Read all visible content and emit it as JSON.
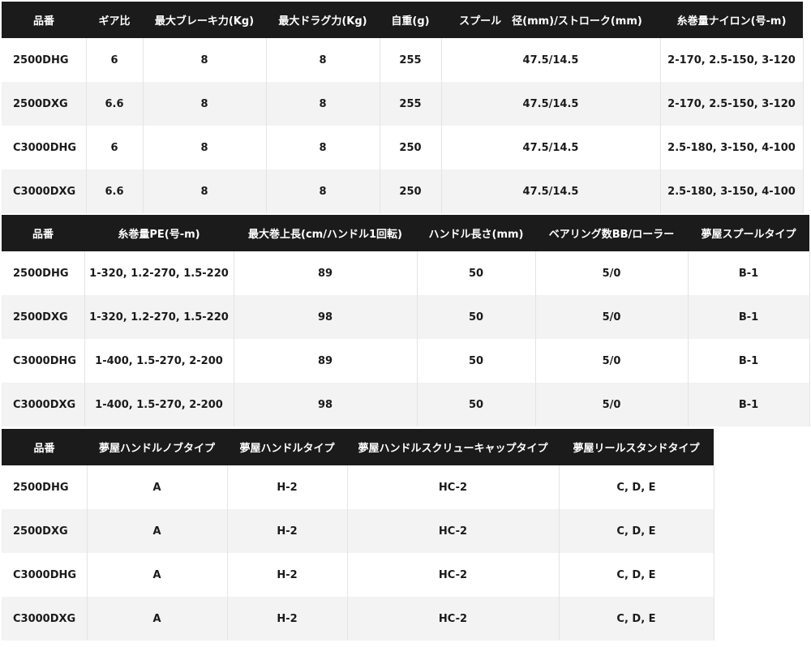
{
  "tables": [
    {
      "headers": [
        "品番",
        "ギア比",
        "最大ブレーキ力(Kg)",
        "最大ドラグ力(Kg)",
        "自重(g)",
        "スプール　径(mm)/ストローク(mm)",
        "糸巻量ナイロン(号-m)"
      ],
      "rows": [
        [
          "2500DHG",
          "6",
          "8",
          "8",
          "255",
          "47.5/14.5",
          "2-170, 2.5-150, 3-120"
        ],
        [
          "2500DXG",
          "6.6",
          "8",
          "8",
          "255",
          "47.5/14.5",
          "2-170, 2.5-150, 3-120"
        ],
        [
          "C3000DHG",
          "6",
          "8",
          "8",
          "250",
          "47.5/14.5",
          "2.5-180, 3-150, 4-100"
        ],
        [
          "C3000DXG",
          "6.6",
          "8",
          "8",
          "250",
          "47.5/14.5",
          "2.5-180, 3-150, 4-100"
        ]
      ]
    },
    {
      "headers": [
        "品番",
        "糸巻量PE(号-m)",
        "最大巻上長(cm/ハンドル1回転)",
        "ハンドル長さ(mm)",
        "ベアリング数BB/ローラー",
        "夢屋スプールタイプ"
      ],
      "rows": [
        [
          "2500DHG",
          "1-320, 1.2-270, 1.5-220",
          "89",
          "50",
          "5/0",
          "B-1"
        ],
        [
          "2500DXG",
          "1-320, 1.2-270, 1.5-220",
          "98",
          "50",
          "5/0",
          "B-1"
        ],
        [
          "C3000DHG",
          "1-400, 1.5-270, 2-200",
          "89",
          "50",
          "5/0",
          "B-1"
        ],
        [
          "C3000DXG",
          "1-400, 1.5-270, 2-200",
          "98",
          "50",
          "5/0",
          "B-1"
        ]
      ]
    },
    {
      "headers": [
        "品番",
        "夢屋ハンドルノブタイプ",
        "夢屋ハンドルタイプ",
        "夢屋ハンドルスクリューキャップタイプ",
        "夢屋リールスタンドタイプ"
      ],
      "rows": [
        [
          "2500DHG",
          "A",
          "H-2",
          "HC-2",
          "C, D, E"
        ],
        [
          "2500DXG",
          "A",
          "H-2",
          "HC-2",
          "C, D, E"
        ],
        [
          "C3000DHG",
          "A",
          "H-2",
          "HC-2",
          "C, D, E"
        ],
        [
          "C3000DXG",
          "A",
          "H-2",
          "HC-2",
          "C, D, E"
        ]
      ]
    }
  ]
}
